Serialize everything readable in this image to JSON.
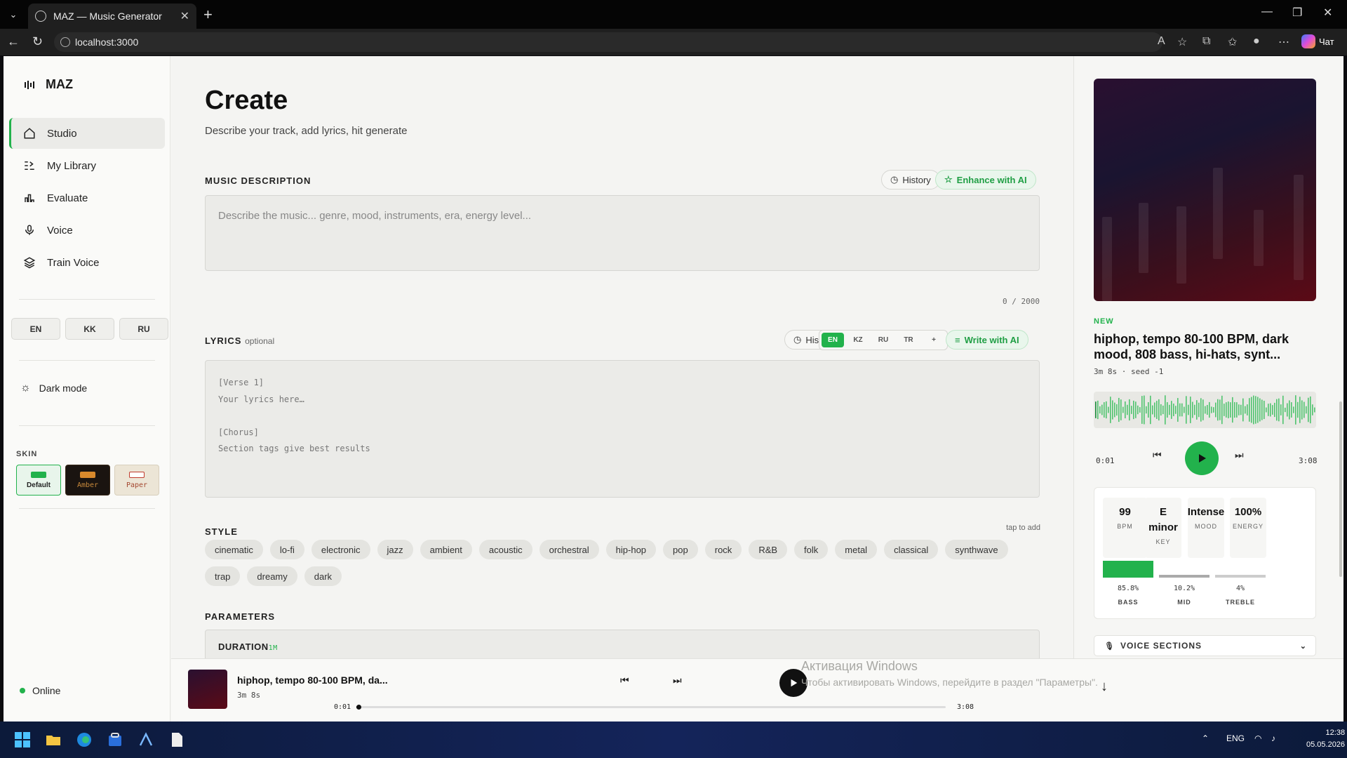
{
  "browser": {
    "tab_title": "MAZ — Music Generator",
    "url": "localhost:3000",
    "chat_label": "Чат"
  },
  "app": {
    "logo": "MAZ",
    "nav": [
      {
        "label": "Studio",
        "icon": "home-icon",
        "active": true
      },
      {
        "label": "My Library",
        "icon": "library-icon"
      },
      {
        "label": "Evaluate",
        "icon": "bar-chart-icon"
      },
      {
        "label": "Voice",
        "icon": "mic-icon"
      },
      {
        "label": "Train Voice",
        "icon": "layers-icon"
      }
    ],
    "ui_langs": [
      "EN",
      "KK",
      "RU"
    ],
    "dark_mode_label": "Dark mode",
    "skin_label": "SKIN",
    "skins": [
      {
        "label": "Default",
        "color": "#22b24c"
      },
      {
        "label": "Amber",
        "color": "#d8892c"
      },
      {
        "label": "Paper",
        "color": "#c0392b"
      }
    ],
    "status": "Online"
  },
  "create": {
    "title": "Create",
    "subtitle": "Describe your track, add lyrics, hit generate",
    "music_description_label": "MUSIC DESCRIPTION",
    "history_label": "History",
    "enhance_label": "Enhance with AI",
    "description_placeholder": "Describe the music... genre, mood, instruments, era, energy level...",
    "char_counter": "0 / 2000",
    "lyrics_label": "LYRICS",
    "lyrics_optional": "optional",
    "lyrics_langs": [
      "EN",
      "KZ",
      "RU",
      "TR",
      "+"
    ],
    "write_ai_label": "Write with AI",
    "lyrics_placeholder": "[Verse 1]\nYour lyrics here…\n\n[Chorus]\nSection tags give best results",
    "style_label": "STYLE",
    "tap_to_add": "tap to add",
    "styles": [
      "cinematic",
      "lo-fi",
      "electronic",
      "jazz",
      "ambient",
      "acoustic",
      "orchestral",
      "hip-hop",
      "pop",
      "rock",
      "R&B",
      "folk",
      "metal",
      "classical",
      "synthwave",
      "trap",
      "dreamy",
      "dark"
    ],
    "parameters_label": "PARAMETERS",
    "duration_label": "DURATION",
    "duration_value": "1M"
  },
  "now_playing": {
    "badge": "NEW",
    "title": "hiphop, tempo 80-100 BPM, dark mood, 808 bass, hi-hats, synt...",
    "meta": "3m 8s · seed -1",
    "time_current": "0:01",
    "time_total": "3:08",
    "stats": [
      {
        "value": "99",
        "label": "BPM"
      },
      {
        "value": "E minor",
        "label": "KEY"
      },
      {
        "value": "Intense",
        "label": "MOOD"
      },
      {
        "value": "100%",
        "label": "ENERGY"
      }
    ],
    "bands": [
      {
        "name": "BASS",
        "pct_label": "85.8%",
        "value": 0.858
      },
      {
        "name": "MID",
        "pct_label": "10.2%",
        "value": 0.102
      },
      {
        "name": "TREBLE",
        "pct_label": "4%",
        "value": 0.04
      }
    ],
    "voice_sections_label": "VOICE SECTIONS"
  },
  "player": {
    "title": "hiphop, tempo 80-100 BPM, da...",
    "meta": "3m 8s",
    "time_current": "0:01",
    "time_total": "3:08",
    "progress": 0.005
  },
  "os": {
    "activation_title": "Активация Windows",
    "activation_text": "Чтобы активировать Windows, перейдите в раздел \"Параметры\".",
    "tray_lang": "ENG",
    "time": "12:38",
    "date": "05.05.2026"
  },
  "colors": {
    "accent": "#22b24c"
  }
}
